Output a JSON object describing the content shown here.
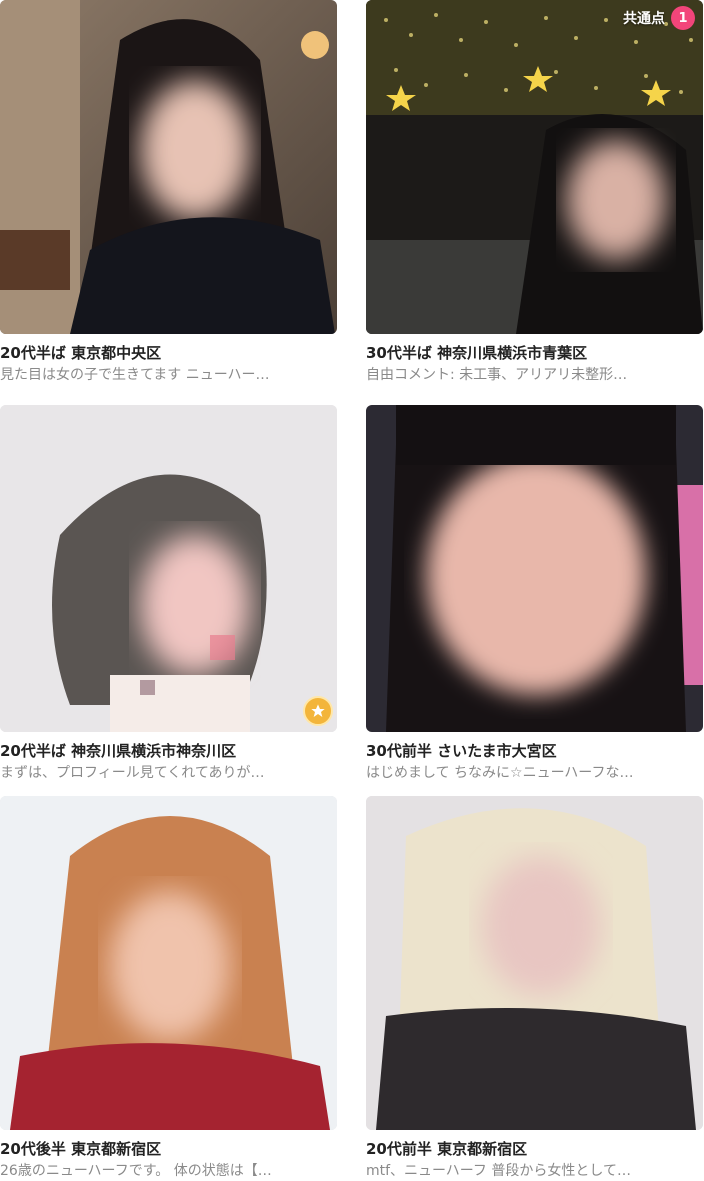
{
  "colors": {
    "title_text": "#222222",
    "desc_text": "#8a8a8a",
    "badge_pink": "#f2457a",
    "star_gold": "#f3b53b"
  },
  "cards": [
    {
      "title": "20代半ば 東京都中央区",
      "description": "見た目は女の子で生きてます ニューハー…"
    },
    {
      "title": "30代半ば 神奈川県横浜市青葉区",
      "description": "自由コメント: 未工事、アリアリ未整形…",
      "common_label": "共通点",
      "common_count": "1"
    },
    {
      "title": "20代半ば 神奈川県横浜市神奈川区",
      "description": "まずは、プロフィール見てくれてありが…",
      "star_icon": "star-badge-icon"
    },
    {
      "title": "30代前半 さいたま市大宮区",
      "description": "はじめまして ちなみに☆ニューハーフな…"
    },
    {
      "title": "20代後半 東京都新宿区",
      "description": "26歳のニューハーフです。 体の状態は【…"
    },
    {
      "title": "20代前半 東京都新宿区",
      "description": "mtf、ニューハーフ 普段から女性として…"
    }
  ]
}
